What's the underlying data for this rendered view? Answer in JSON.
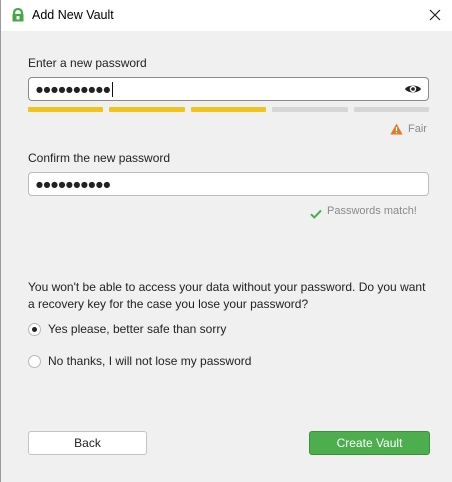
{
  "window": {
    "title": "Add New Vault",
    "app_icon": "cryptomator-vault-icon",
    "close_icon": "close-icon"
  },
  "new_password": {
    "label": "Enter a new password",
    "masked_value": "●●●●●●●●●●",
    "toggle_icon": "eye-icon"
  },
  "strength": {
    "segments_filled": 3,
    "segments_total": 5,
    "filled_color": "#f0c419",
    "empty_color": "#d6d6d6",
    "label": "Fair",
    "warning_icon": "warning-triangle-icon",
    "warning_color": "#e07b2a"
  },
  "confirm_password": {
    "label": "Confirm the new password",
    "masked_value": "●●●●●●●●●●"
  },
  "match": {
    "label": "Passwords match!",
    "check_icon": "check-icon",
    "check_color": "#4cae4c"
  },
  "recovery": {
    "question": "You won't be able to access your data without your password. Do you want a recovery key for the case you lose your password?",
    "options": [
      {
        "label": "Yes please, better safe than sorry",
        "selected": true
      },
      {
        "label": "No thanks, I will not lose my password",
        "selected": false
      }
    ]
  },
  "buttons": {
    "back": "Back",
    "create": "Create Vault"
  },
  "colors": {
    "primary_green": "#4cae4c",
    "content_bg": "#f0f0f0"
  }
}
